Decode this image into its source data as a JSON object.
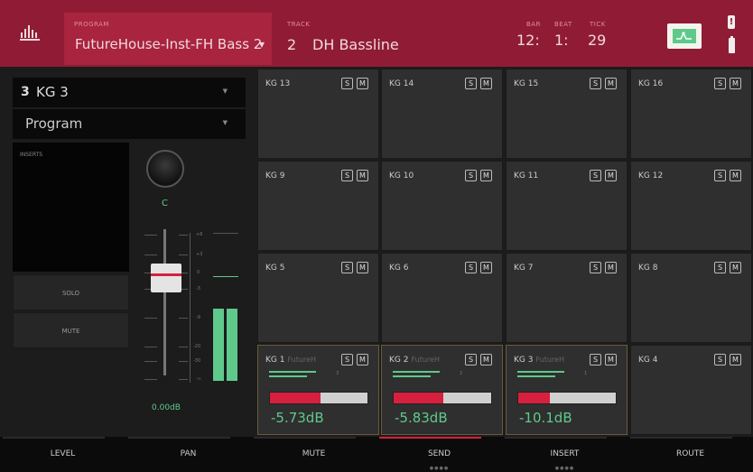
{
  "header": {
    "program_label": "PROGRAM",
    "program_name": "FutureHouse-Inst-FH Bass 2",
    "track_label": "TRACK",
    "track_number": "2",
    "track_name": "DH Bassline",
    "bar_label": "BAR",
    "beat_label": "BEAT",
    "tick_label": "TICK",
    "bar_value": "12:",
    "beat_value": "1:",
    "tick_value": "29",
    "automation_icon": "automation-read-icon",
    "alert_glyph": "!"
  },
  "left": {
    "keygroup_number": "3",
    "keygroup_name": "KG 3",
    "mixer_source": "Program",
    "inserts_label": "INSERTS",
    "solo_label": "SOLO",
    "mute_label": "MUTE",
    "pan_value": "C",
    "level_value": "0.00dB",
    "scale": [
      "+6",
      "+3",
      "0",
      "-3",
      "-9",
      "-20",
      "-30",
      "-∞"
    ]
  },
  "pads": [
    {
      "name": "KG 13",
      "sub": ""
    },
    {
      "name": "KG 14",
      "sub": ""
    },
    {
      "name": "KG 15",
      "sub": ""
    },
    {
      "name": "KG 16",
      "sub": ""
    },
    {
      "name": "KG 9",
      "sub": ""
    },
    {
      "name": "KG 10",
      "sub": ""
    },
    {
      "name": "KG 11",
      "sub": ""
    },
    {
      "name": "KG 12",
      "sub": ""
    },
    {
      "name": "KG 5",
      "sub": ""
    },
    {
      "name": "KG 6",
      "sub": ""
    },
    {
      "name": "KG 7",
      "sub": ""
    },
    {
      "name": "KG 8",
      "sub": ""
    },
    {
      "name": "KG 1",
      "sub": "FutureH",
      "send_number": "3",
      "send_level": 0.52,
      "db": "-5.73dB"
    },
    {
      "name": "KG 2",
      "sub": "FutureH",
      "send_number": "2",
      "send_level": 0.51,
      "db": "-5.83dB"
    },
    {
      "name": "KG 3",
      "sub": "FutureH",
      "send_number": "1",
      "send_level": 0.32,
      "db": "-10.1dB"
    },
    {
      "name": "KG 4",
      "sub": ""
    }
  ],
  "pad_solo": "S",
  "pad_mute": "M",
  "tabs": [
    "LEVEL",
    "PAN",
    "MUTE",
    "SEND",
    "INSERT",
    "ROUTE"
  ],
  "active_tab": "SEND",
  "tab_dots": {
    "SEND": "●●●●",
    "INSERT": "●●●●"
  },
  "colors": {
    "header": "#8f1c34",
    "accent_red": "#d6203e",
    "accent_green": "#5fc98b"
  }
}
